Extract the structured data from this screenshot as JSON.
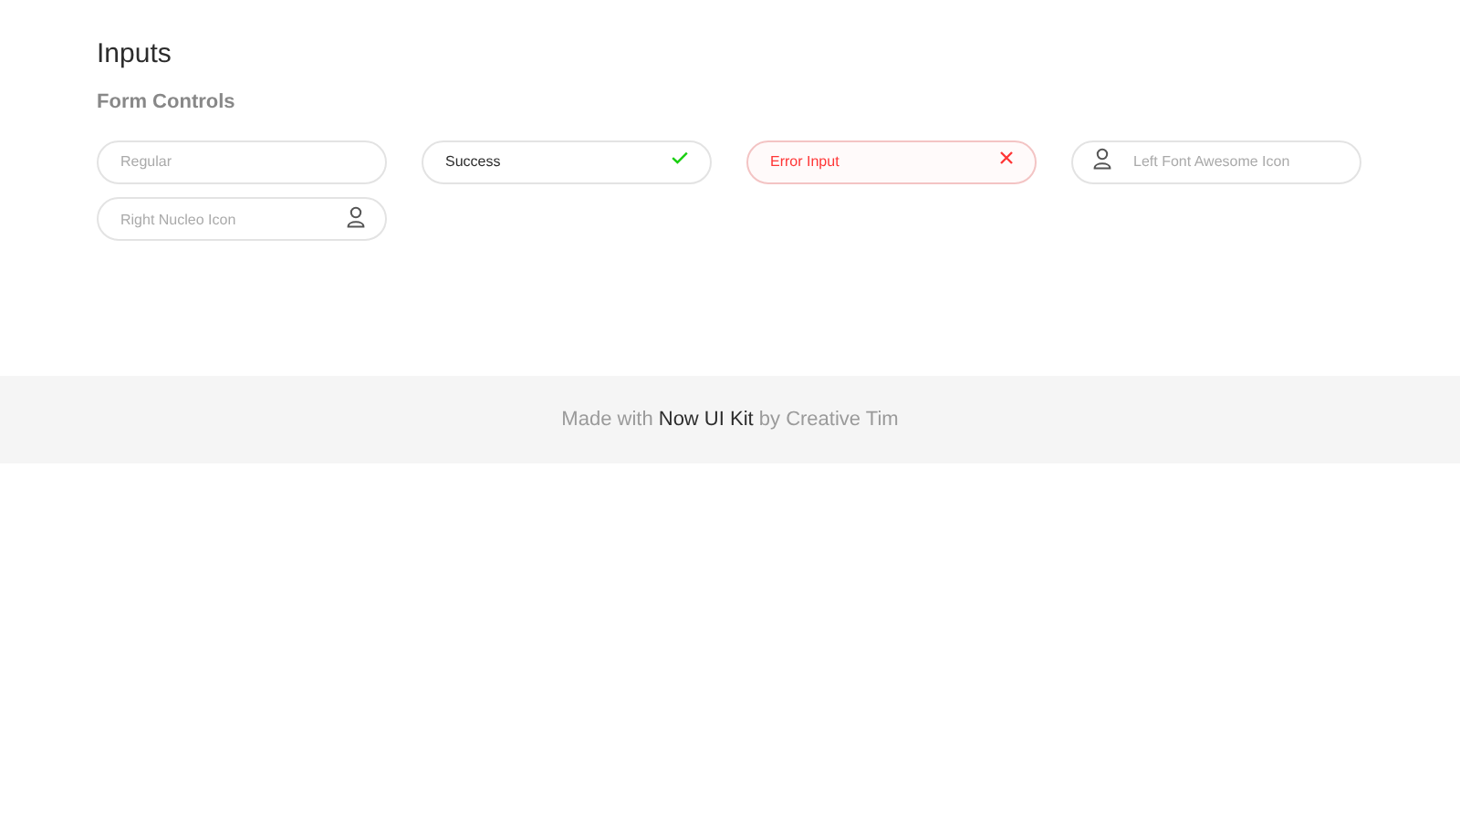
{
  "title": "Inputs",
  "subtitle": "Form Controls",
  "inputs": [
    {
      "placeholder": "Regular",
      "kind": "regular"
    },
    {
      "value": "Success",
      "kind": "success"
    },
    {
      "value": "Error Input",
      "kind": "error"
    },
    {
      "placeholder": "Left Font Awesome Icon",
      "kind": "icon-left"
    },
    {
      "placeholder": "Right Nucleo Icon",
      "kind": "icon-right"
    }
  ],
  "footer": "Made with **Now UI Kit** by Creative Tim"
}
